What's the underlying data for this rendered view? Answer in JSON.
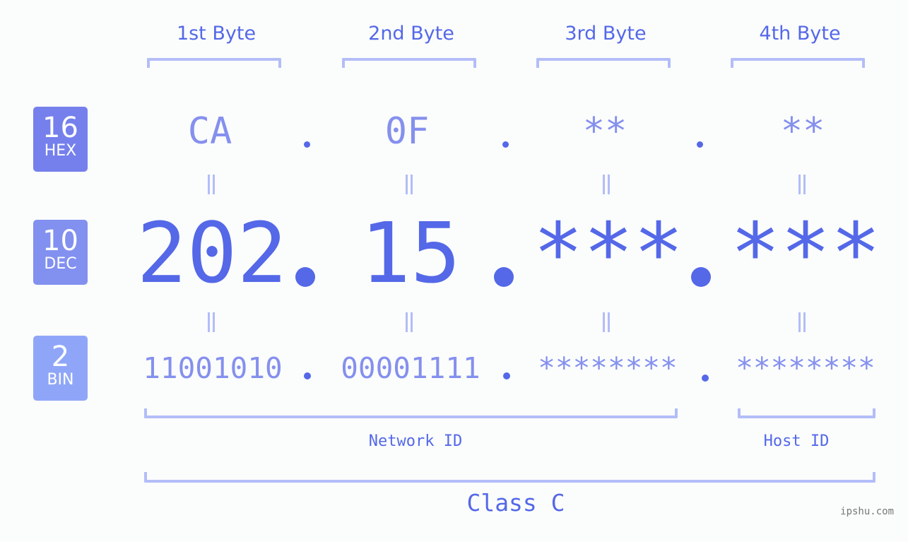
{
  "byte_headers": [
    "1st Byte",
    "2nd Byte",
    "3rd Byte",
    "4th Byte"
  ],
  "badges": [
    {
      "num": "16",
      "label": "HEX",
      "color": "#7580ec"
    },
    {
      "num": "10",
      "label": "DEC",
      "color": "#8290f0"
    },
    {
      "num": "2",
      "label": "BIN",
      "color": "#8fa6f8"
    }
  ],
  "hex": [
    "CA",
    "0F",
    "**",
    "**"
  ],
  "dec": [
    "202",
    "15",
    "***",
    "***"
  ],
  "bin": [
    "11001010",
    "00001111",
    "********",
    "********"
  ],
  "network_label": "Network ID",
  "host_label": "Host ID",
  "class_label": "Class C",
  "watermark": "ipshu.com",
  "colors": {
    "primary": "#5468e8",
    "secondary": "#8590ee",
    "bracket": "#b3bdf8",
    "background": "#fbfdfc"
  }
}
